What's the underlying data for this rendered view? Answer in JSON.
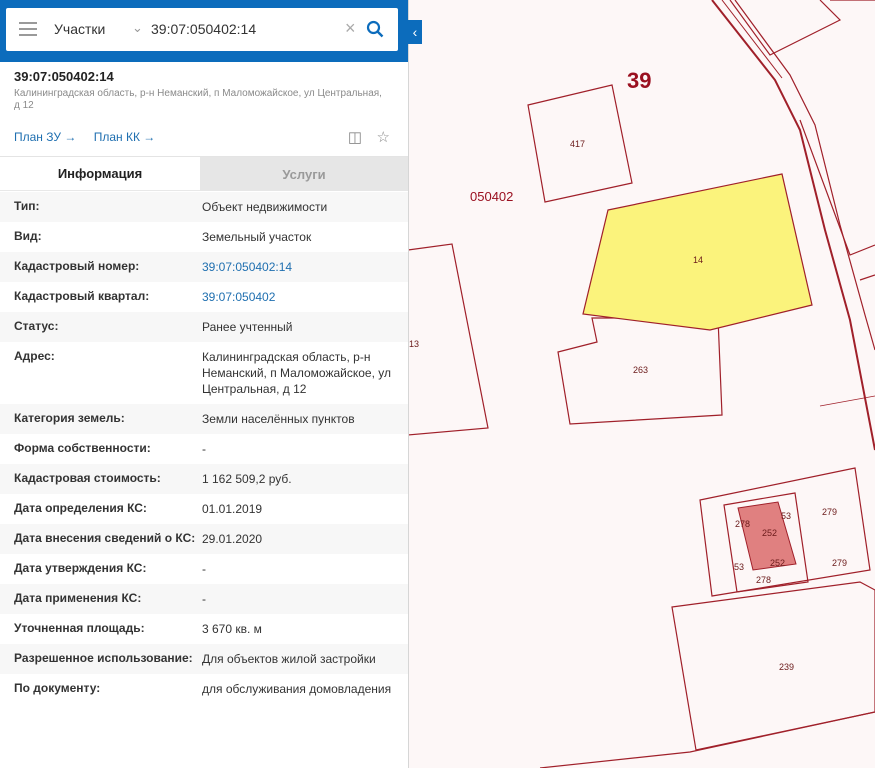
{
  "search": {
    "type_select": "Участки",
    "query": "39:07:050402:14"
  },
  "object": {
    "id": "39:07:050402:14",
    "address_line": "Калининградская область, р-н Неманский, п Маломожайское, ул Центральная, д 12",
    "links": [
      "План ЗУ →",
      "План КК →"
    ]
  },
  "tabs": [
    {
      "label": "Информация"
    },
    {
      "label": "Услуги"
    }
  ],
  "info": [
    {
      "key": "Тип:",
      "value": "Объект недвижимости"
    },
    {
      "key": "Вид:",
      "value": "Земельный участок"
    },
    {
      "key": "Кадастровый номер:",
      "value": "39:07:050402:14"
    },
    {
      "key": "Кадастровый квартал:",
      "value": "39:07:050402"
    },
    {
      "key": "Статус:",
      "value": "Ранее учтенный"
    },
    {
      "key": "Адрес:",
      "value": "Калининградская область, р-н Неманский, п Маломожайское, ул Центральная, д 12"
    },
    {
      "key": "Категория земель:",
      "value": "Земли населённых пунктов"
    },
    {
      "key": "Форма собственности:",
      "value": "-"
    },
    {
      "key": "Кадастровая стоимость:",
      "value": "1 162 509,2 руб."
    },
    {
      "key": "Дата определения КС:",
      "value": "01.01.2019"
    },
    {
      "key": "Дата внесения сведений о КС:",
      "value": "29.01.2020"
    },
    {
      "key": "Дата утверждения КС:",
      "value": "-"
    },
    {
      "key": "Дата применения КС:",
      "value": "-"
    },
    {
      "key": "Уточненная площадь:",
      "value": "3 670 кв. м"
    },
    {
      "key": "Разрешенное использование:",
      "value": "Для объектов жилой застройки"
    },
    {
      "key": "По документу:",
      "value": "для обслуживания домовладения"
    }
  ],
  "map": {
    "district_label": "39",
    "quarter_label": "050402",
    "parcel_labels": [
      "417",
      "14",
      "263",
      "13",
      "278",
      "252",
      "53",
      "252",
      "53",
      "278",
      "279",
      "279",
      "239"
    ],
    "colors": {
      "accent": "#0c6cbc",
      "parcel_line": "#a0202a",
      "selected_fill": "#fbf37c",
      "building_fill": "#e08080"
    }
  }
}
